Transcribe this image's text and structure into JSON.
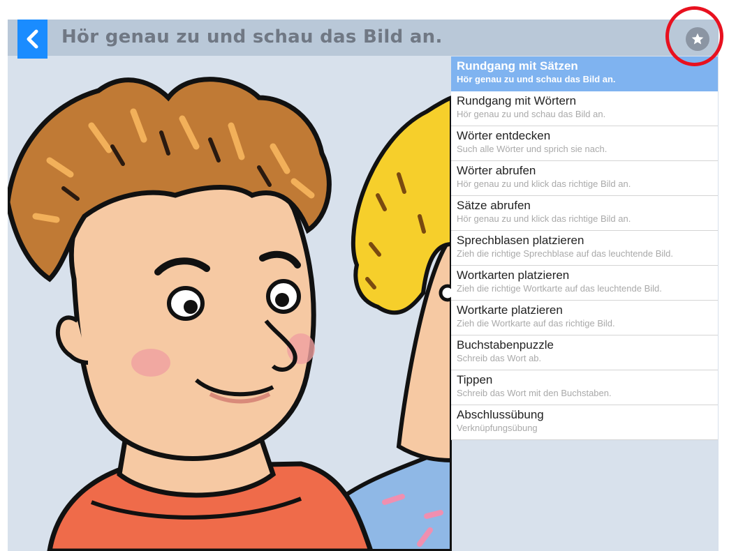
{
  "header": {
    "title": "Hör genau zu und schau das Bild an.",
    "back_icon": "chevron-left-icon",
    "star_icon": "star-icon"
  },
  "colors": {
    "back_button": "#1a8cff",
    "header_bar": "#b9c8d8",
    "active_item": "#7fb3f0",
    "highlight_ring": "#e8111f"
  },
  "menu": {
    "items": [
      {
        "label": "Rundgang mit Sätzen",
        "sub": "Hör genau zu und schau das Bild an."
      },
      {
        "label": "Rundgang mit Wörtern",
        "sub": "Hör genau zu und schau das Bild an."
      },
      {
        "label": "Wörter entdecken",
        "sub": "Such alle Wörter und sprich sie nach."
      },
      {
        "label": "Wörter abrufen",
        "sub": "Hör genau zu und klick das richtige Bild an."
      },
      {
        "label": "Sätze abrufen",
        "sub": "Hör genau zu und klick das richtige Bild an."
      },
      {
        "label": "Sprechblasen platzieren",
        "sub": "Zieh die richtige Sprechblase auf das leuchtende Bild."
      },
      {
        "label": "Wortkarten platzieren",
        "sub": "Zieh die richtige Wortkarte auf das leuchtende Bild."
      },
      {
        "label": "Wortkarte platzieren",
        "sub": "Zieh die Wortkarte auf das richtige Bild."
      },
      {
        "label": "Buchstabenpuzzle",
        "sub": "Schreib das Wort ab."
      },
      {
        "label": "Tippen",
        "sub": "Schreib das Wort mit den Buchstaben."
      },
      {
        "label": "Abschlussübung",
        "sub": "Verknüpfungsübung"
      }
    ]
  }
}
